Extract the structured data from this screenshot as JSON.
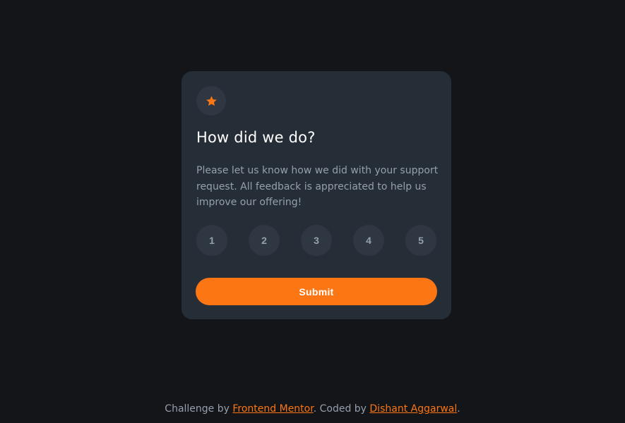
{
  "colors": {
    "background": "#131518",
    "card": "#252d37",
    "circle": "#2f3742",
    "accent": "#fc7614",
    "text_muted": "#969fad",
    "text_light": "#ffffff"
  },
  "card": {
    "icon": "star-icon",
    "title": "How did we do?",
    "description": "Please let us know how we did with your support request. All feedback is appreciated to help us improve our offering!",
    "ratings": [
      "1",
      "2",
      "3",
      "4",
      "5"
    ],
    "submit_label": "Submit"
  },
  "footer": {
    "prefix": "Challenge by ",
    "link1": "Frontend Mentor",
    "middle": ". Coded by ",
    "link2": "Dishant Aggarwal",
    "suffix": "."
  }
}
